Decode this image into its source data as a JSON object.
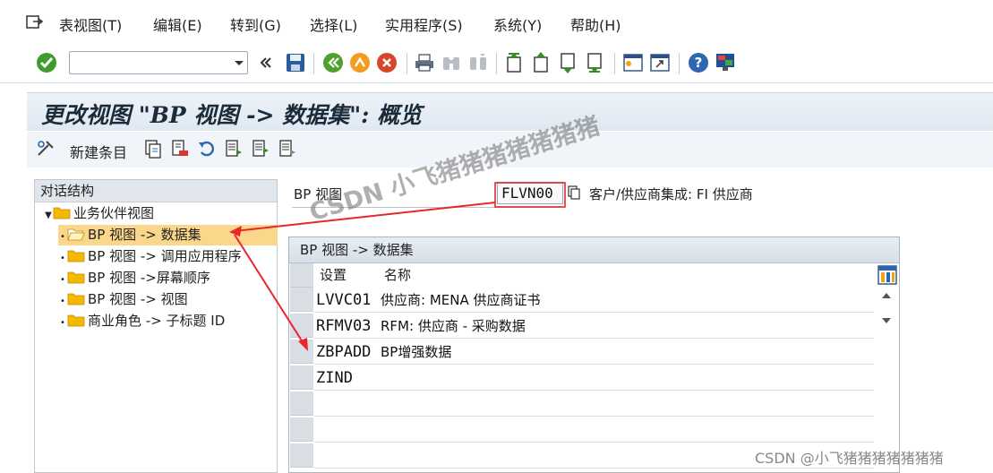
{
  "menubar": {
    "items": [
      "表视图(T)",
      "编辑(E)",
      "转到(G)",
      "选择(L)",
      "实用程序(S)",
      "系统(Y)",
      "帮助(H)"
    ]
  },
  "toolbar": {
    "command_value": "",
    "icons": [
      "enter-icon",
      "back-double-icon",
      "save-icon",
      "back-icon",
      "exit-icon",
      "cancel-icon",
      "print-icon",
      "find-icon",
      "find-next-icon",
      "first-page-icon",
      "prev-page-icon",
      "next-page-icon",
      "last-page-icon",
      "new-session-icon",
      "shortcut-icon",
      "help-icon",
      "customize-layout-icon"
    ]
  },
  "title": "更改视图 \"BP 视图 -> 数据集\": 概览",
  "app_toolbar": {
    "new_entries": "新建条目"
  },
  "tree": {
    "header": "对话结构",
    "root": "业务伙伴视图",
    "items": [
      "BP 视图 -> 数据集",
      "BP 视图 -> 调用应用程序",
      "BP 视图 ->屏幕顺序",
      "BP 视图 -> 视图",
      "商业角色 -> 子标题 ID"
    ],
    "selected_index": 0
  },
  "field": {
    "label": "BP 视图",
    "value": "FLVN00",
    "description": "客户/供应商集成: FI 供应商"
  },
  "table": {
    "title": "BP 视图 -> 数据集",
    "columns": [
      "设置",
      "名称"
    ],
    "rows": [
      {
        "key": "LVVC01",
        "name": "供应商: MENA 供应商证书"
      },
      {
        "key": "RFMV03",
        "name": "RFM: 供应商 - 采购数据"
      },
      {
        "key": "ZBPADD",
        "name": "BP增强数据"
      },
      {
        "key": "ZIND",
        "name": ""
      },
      {
        "key": "",
        "name": ""
      },
      {
        "key": "",
        "name": ""
      },
      {
        "key": "",
        "name": ""
      }
    ]
  },
  "watermarks": {
    "overlay": "CSDN 小飞猪猪猪猪猪猪猪",
    "corner": "CSDN @小飞猪猪猪猪猪猪猪"
  },
  "colors": {
    "selected_row": "#fbd78b",
    "arrow": "#e8262b",
    "folder": "#f5b800"
  }
}
